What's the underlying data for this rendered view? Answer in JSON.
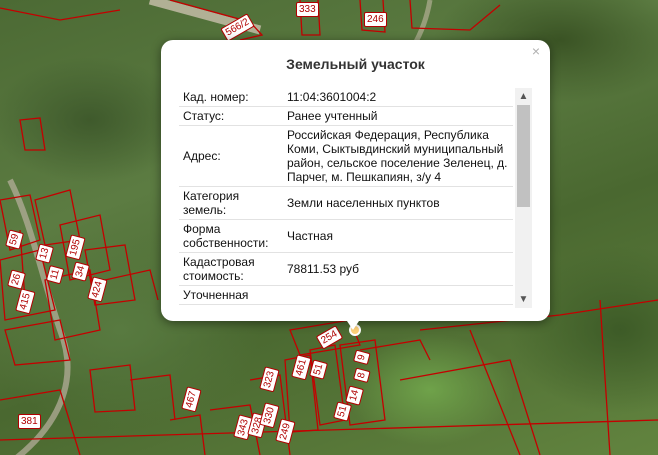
{
  "map": {
    "parcel_labels": [
      "566/2",
      "333",
      "246",
      "59",
      "13",
      "195",
      "11",
      "34",
      "26",
      "415",
      "424",
      "254",
      "461",
      "51",
      "9",
      "8",
      "14",
      "51",
      "323",
      "467",
      "343",
      "328",
      "330",
      "249",
      "381"
    ]
  },
  "popup": {
    "title": "Земельный участок",
    "close_symbol": "×",
    "rows": [
      {
        "label": "Кад. номер:",
        "value": "11:04:3601004:2"
      },
      {
        "label": "Статус:",
        "value": "Ранее учтенный"
      },
      {
        "label": "Адрес:",
        "value": "Российская Федерация, Республика Коми, Сыктывдинский муниципальный район, сельское поселение Зеленец, д. Парчег, м. Пешкапиян, з/у 4"
      },
      {
        "label": "Категория земель:",
        "value": "Земли населенных пунктов"
      },
      {
        "label": "Форма собственности:",
        "value": "Частная"
      },
      {
        "label": "Кадастровая стоимость:",
        "value": "78811.53 руб"
      },
      {
        "label": "Уточненная",
        "value": ""
      }
    ],
    "scroll_up_icon": "▲",
    "scroll_down_icon": "▼"
  }
}
